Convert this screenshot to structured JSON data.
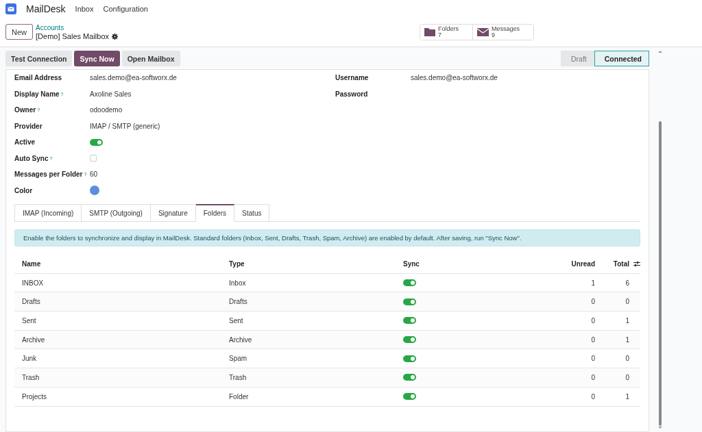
{
  "app": {
    "name": "MailDesk",
    "menu": [
      "Inbox",
      "Configuration"
    ]
  },
  "control": {
    "new_button": "New",
    "breadcrumb_parent": "Accounts",
    "record_title": "[Demo] Sales Mailbox",
    "stats": [
      {
        "kind": "folder",
        "label": "Folders",
        "value": "7"
      },
      {
        "kind": "envelope",
        "label": "Messages",
        "value": "9"
      }
    ]
  },
  "actions": [
    {
      "label": "Test Connection",
      "kind": "secondary"
    },
    {
      "label": "Sync Now",
      "kind": "primary"
    },
    {
      "label": "Open Mailbox",
      "kind": "secondary"
    }
  ],
  "status_stages": [
    {
      "label": "Draft",
      "selected": false
    },
    {
      "label": "Connected",
      "selected": true
    }
  ],
  "fields_left": [
    {
      "kind": "text",
      "label": "Email Address",
      "value": "sales.demo@ea-softworx.de"
    },
    {
      "kind": "text",
      "label": "Display Name",
      "help": "?",
      "value": "Axoline Sales"
    },
    {
      "kind": "text",
      "label": "Owner",
      "help": "?",
      "value": "odoodemo"
    },
    {
      "kind": "text",
      "label": "Provider",
      "value": "IMAP / SMTP (generic)"
    },
    {
      "kind": "toggle",
      "label": "Active",
      "on": true
    },
    {
      "kind": "checkbox",
      "label": "Auto Sync",
      "help": "?",
      "checked": false
    },
    {
      "kind": "text",
      "label": "Messages per Folder",
      "help": "?",
      "value": "60"
    },
    {
      "kind": "color",
      "label": "Color",
      "color": "#5b8fdc"
    }
  ],
  "fields_right": [
    {
      "label": "Username",
      "value": "sales.demo@ea-softworx.de"
    },
    {
      "label": "Password"
    }
  ],
  "tabs": [
    {
      "label": "IMAP (Incoming)",
      "selected": false
    },
    {
      "label": "SMTP (Outgoing)",
      "selected": false
    },
    {
      "label": "Signature",
      "selected": false
    },
    {
      "label": "Folders",
      "selected": true
    },
    {
      "label": "Status",
      "selected": false
    }
  ],
  "notice": "Enable the folders to synchronize and display in MailDesk. Standard folders (Inbox, Sent, Drafts, Trash, Spam, Archive) are enabled by default. After saving, run \"Sync Now\".",
  "table": {
    "columns": [
      "Name",
      "Type",
      "Sync",
      "Unread",
      "Total"
    ],
    "rows": [
      {
        "name": "INBOX",
        "type": "Inbox",
        "sync": true,
        "unread": "1",
        "total": "6"
      },
      {
        "name": "Drafts",
        "type": "Drafts",
        "sync": true,
        "unread": "0",
        "total": "0"
      },
      {
        "name": "Sent",
        "type": "Sent",
        "sync": true,
        "unread": "0",
        "total": "1"
      },
      {
        "name": "Archive",
        "type": "Archive",
        "sync": true,
        "unread": "0",
        "total": "1"
      },
      {
        "name": "Junk",
        "type": "Spam",
        "sync": true,
        "unread": "0",
        "total": "0"
      },
      {
        "name": "Trash",
        "type": "Trash",
        "sync": true,
        "unread": "0",
        "total": "0"
      },
      {
        "name": "Projects",
        "type": "Folder",
        "sync": true,
        "unread": "0",
        "total": "1"
      }
    ]
  }
}
